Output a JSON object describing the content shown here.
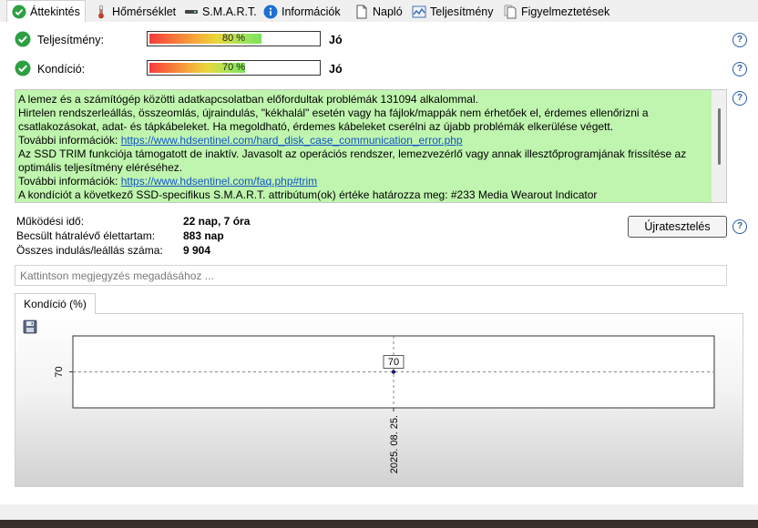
{
  "tabs": [
    {
      "label": "Áttekintés",
      "icon": "check-circle-icon",
      "active": true
    },
    {
      "label": "Hőmérséklet",
      "icon": "thermometer-icon"
    },
    {
      "label": "S.M.A.R.T.",
      "icon": "drive-icon"
    },
    {
      "label": "Információk",
      "icon": "info-icon"
    },
    {
      "label": "Napló",
      "icon": "document-icon"
    },
    {
      "label": "Teljesítmény",
      "icon": "performance-chart-icon"
    },
    {
      "label": "Figyelmeztetések",
      "icon": "alerts-icon"
    }
  ],
  "metrics": {
    "performance": {
      "label": "Teljesítmény:",
      "percent": 80,
      "bar_text": "80 %",
      "verdict": "Jó"
    },
    "health": {
      "label": "Kondíció:",
      "percent": 70,
      "bar_text": "70 %",
      "verdict": "Jó"
    }
  },
  "message": {
    "lines": [
      {
        "text": "A lemez és a számítógép közötti adatkapcsolatban előfordultak problémák 131094 alkalommal."
      },
      {
        "text": "Hirtelen rendszerleállás, összeomlás, újraindulás, \"kékhalál\" esetén vagy ha fájlok/mappák nem érhetőek el, érdemes ellenőrizni a csatlakozásokat, adat- és tápkábeleket. Ha megoldható, érdemes kábeleket cserélni az újabb problémák elkerülése végett."
      },
      {
        "prefix": "További információk: ",
        "link": "https://www.hdsentinel.com/hard_disk_case_communication_error.php"
      },
      {
        "text": "Az SSD TRIM funkciója támogatott de inaktív. Javasolt az operációs rendszer, lemezvezérlő vagy annak illesztőprogramjának frissítése az optimális teljesítmény eléréséhez."
      },
      {
        "prefix": "További információk: ",
        "link": "https://www.hdsentinel.com/faq.php#trim"
      },
      {
        "text": "A kondíciót a következő SSD-specifikus S.M.A.R.T. attribútum(ok) értéke határozza meg:  #233 Media Wearout Indicator"
      }
    ]
  },
  "stats": [
    {
      "label": "Működési idő:",
      "value": "22 nap, 7 óra"
    },
    {
      "label": "Becsült hátralévő élettartam:",
      "value": "883 nap"
    },
    {
      "label": "Összes indulás/leállás száma:",
      "value": "9 904"
    }
  ],
  "retest_label": "Újratesztelés",
  "note_placeholder": "Kattintson megjegyzés megadásához ...",
  "chart_tab_label": "Kondíció  (%)",
  "colors": {
    "message_bg": "#bff5ae",
    "link": "#1155cc",
    "help": "#2b5ea7",
    "check": "#2ea043"
  },
  "chart_data": {
    "type": "line",
    "x": [
      "2025. 08. 25."
    ],
    "series": [
      {
        "values": [
          70
        ]
      }
    ],
    "y_tick_labels": [
      "70"
    ],
    "data_labels": [
      "70"
    ],
    "grid": true,
    "legend": "none"
  }
}
